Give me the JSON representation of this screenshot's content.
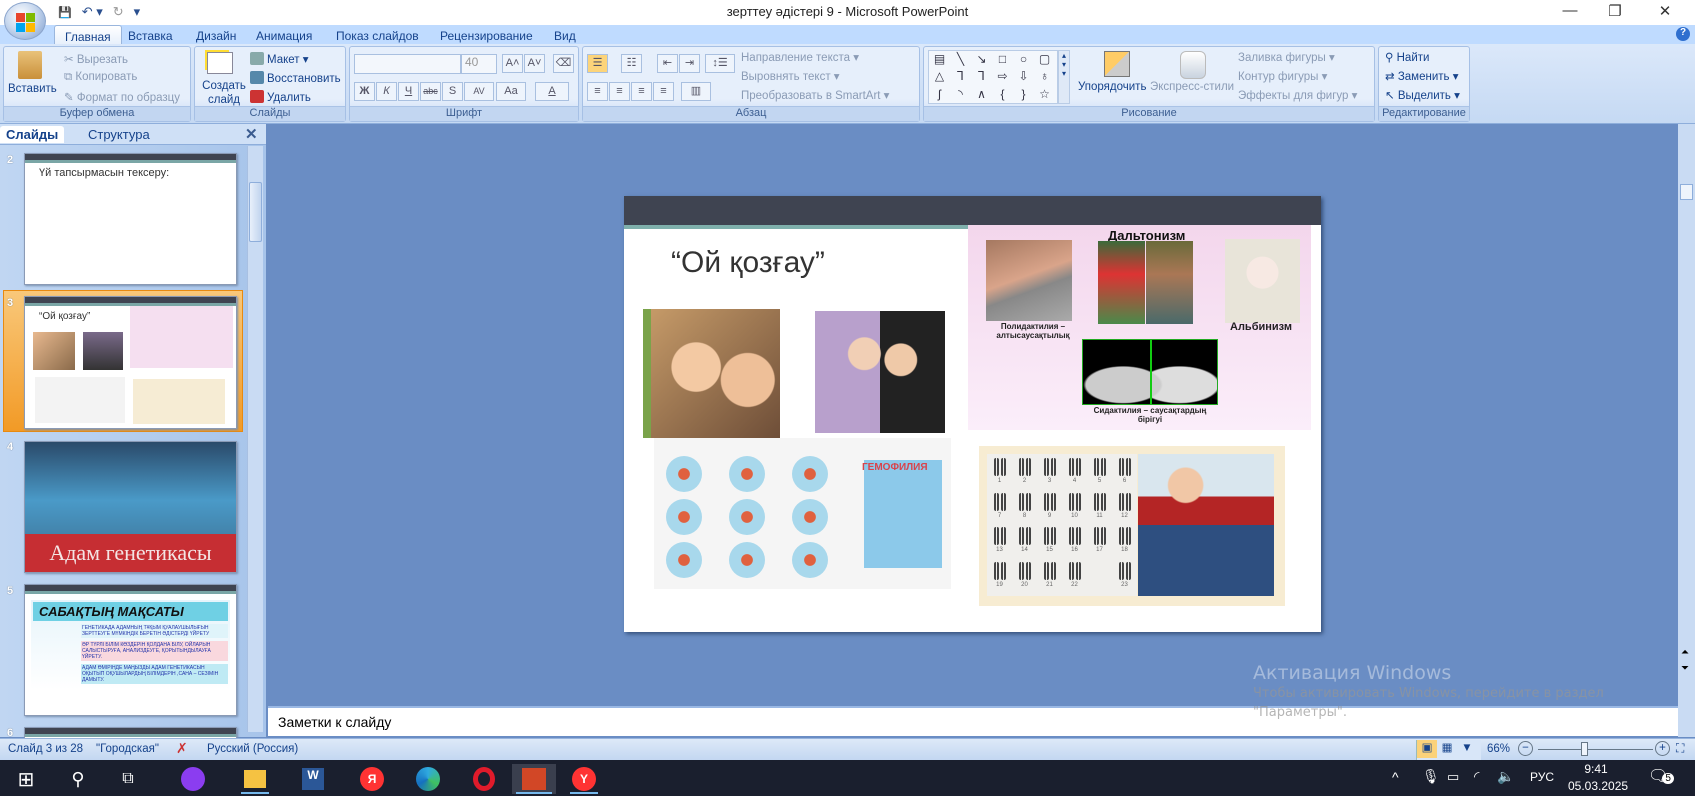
{
  "window": {
    "title": "зерттеу әдістері 9 - Microsoft PowerPoint",
    "minimize": "—",
    "maximize": "❐",
    "close": "✕"
  },
  "qat": {
    "save": "💾",
    "undo": "↶ ▾",
    "redo": "↻",
    "customize": "▾"
  },
  "ribbon_tabs": [
    "Главная",
    "Вставка",
    "Дизайн",
    "Анимация",
    "Показ слайдов",
    "Рецензирование",
    "Вид"
  ],
  "help": "?",
  "clipboard": {
    "label": "Буфер обмена",
    "paste": "Вставить",
    "cut": "Вырезать",
    "copy": "Копировать",
    "format_painter": "Формат по образцу"
  },
  "slides_group": {
    "label": "Слайды",
    "new_slide": "Создать слайд",
    "layout": "Макет ▾",
    "reset": "Восстановить",
    "delete": "Удалить"
  },
  "font": {
    "label": "Шрифт",
    "font_name": "",
    "font_size": "40",
    "grow": "A˄",
    "shrink": "A˅",
    "clear": "⌫",
    "bold": "Ж",
    "italic": "К",
    "underline": "Ч",
    "strike": "abc",
    "shadow": "S",
    "spacing": "AV",
    "case": "Aa",
    "color": "A"
  },
  "paragraph": {
    "label": "Абзац",
    "text_direction": "Направление текста ▾",
    "align_text": "Выровнять текст ▾",
    "smartart": "Преобразовать в SmartArt ▾"
  },
  "drawing": {
    "label": "Рисование",
    "arrange": "Упорядочить",
    "quick_styles": "Экспресс-стили",
    "fill": "Заливка фигуры ▾",
    "outline": "Контур фигуры ▾",
    "effects": "Эффекты для фигур ▾",
    "shapes": [
      "▤",
      "╲",
      "↘",
      "□",
      "○",
      "▢",
      "△",
      "⅂",
      "⅂",
      "⇨",
      "⇩",
      "♁",
      "ʃ",
      "◝",
      "∧",
      "{",
      "}",
      "☆"
    ]
  },
  "editing": {
    "label": "Редактирование",
    "find": "Найти",
    "replace": "Заменить ▾",
    "select": "Выделить ▾"
  },
  "left_pane": {
    "tabs": [
      "Слайды",
      "Структура"
    ],
    "close": "✕",
    "thumbs": [
      {
        "num": "2",
        "title": "Үй тапсырмасын тексеру:"
      },
      {
        "num": "3",
        "title": "“Ой қозғау”"
      },
      {
        "num": "4",
        "title": "Адам генетикасы"
      },
      {
        "num": "5",
        "title": "САБАҚТЫҢ МАҚСАТЫ",
        "items": [
          "ГЕНЕТИКАДА АДАМНЫҢ ТҰҚЫМ ҚУАЛАУШЫЛЫҒЫН ЗЕРТТЕУГЕ МҮМКІНДІК БЕРЕТІН ӘДІСТЕРДІ ҮЙРЕТУ",
          "ӘР ТҮРЛІ БІЛІМ КӨЗДЕРІН ҚОЛДАНА БІЛУ, ОЙЛАРЫН САЛЫСТЫРУҒА, АНАЛИЗДЕУГЕ, ҚОРЫТЫНДЫЛАУҒА ҮЙРЕТУ.",
          "АДАМ ӨМІРІНДЕ МАҢЫЗДЫ АДАМ ГЕНЕТИКАСЫН ОҚЫТЫП ОҚУШЫЛАРДЫҢ БІЛІМДЕРІН ,САНА – СЕЗІМІН ДАМЫТУ."
        ]
      },
      {
        "num": "6"
      }
    ]
  },
  "slide": {
    "title": "“Ой қозғау”",
    "collage": {
      "heading": "Дальтонизм",
      "polydactyly": "Полидактилия – алтысаусақтылық",
      "albinism": "Альбинизм",
      "syndactyly": "Сидактилия – саусақтардың бірігуі"
    },
    "hemophilia": "ГЕМОФИЛИЯ",
    "karyotype_numbers": [
      "1",
      "2",
      "3",
      "4",
      "5",
      "6",
      "7",
      "8",
      "9",
      "10",
      "11",
      "12",
      "13",
      "14",
      "15",
      "16",
      "17",
      "18",
      "19",
      "20",
      "21",
      "22",
      "",
      "23"
    ]
  },
  "notes": {
    "placeholder": "Заметки к слайду"
  },
  "watermark": {
    "title": "Активация Windows",
    "text": "Чтобы активировать Windows, перейдите в раздел \"Параметры\"."
  },
  "status": {
    "slide": "Слайд 3 из 28",
    "theme": "\"Городская\"",
    "language": "Русский (Россия)",
    "zoom": "66%",
    "zoom_fraction": 0.4
  },
  "taskbar": {
    "time": "9:41",
    "date": "05.03.2025",
    "lang": "РУС",
    "notifications": "5"
  }
}
